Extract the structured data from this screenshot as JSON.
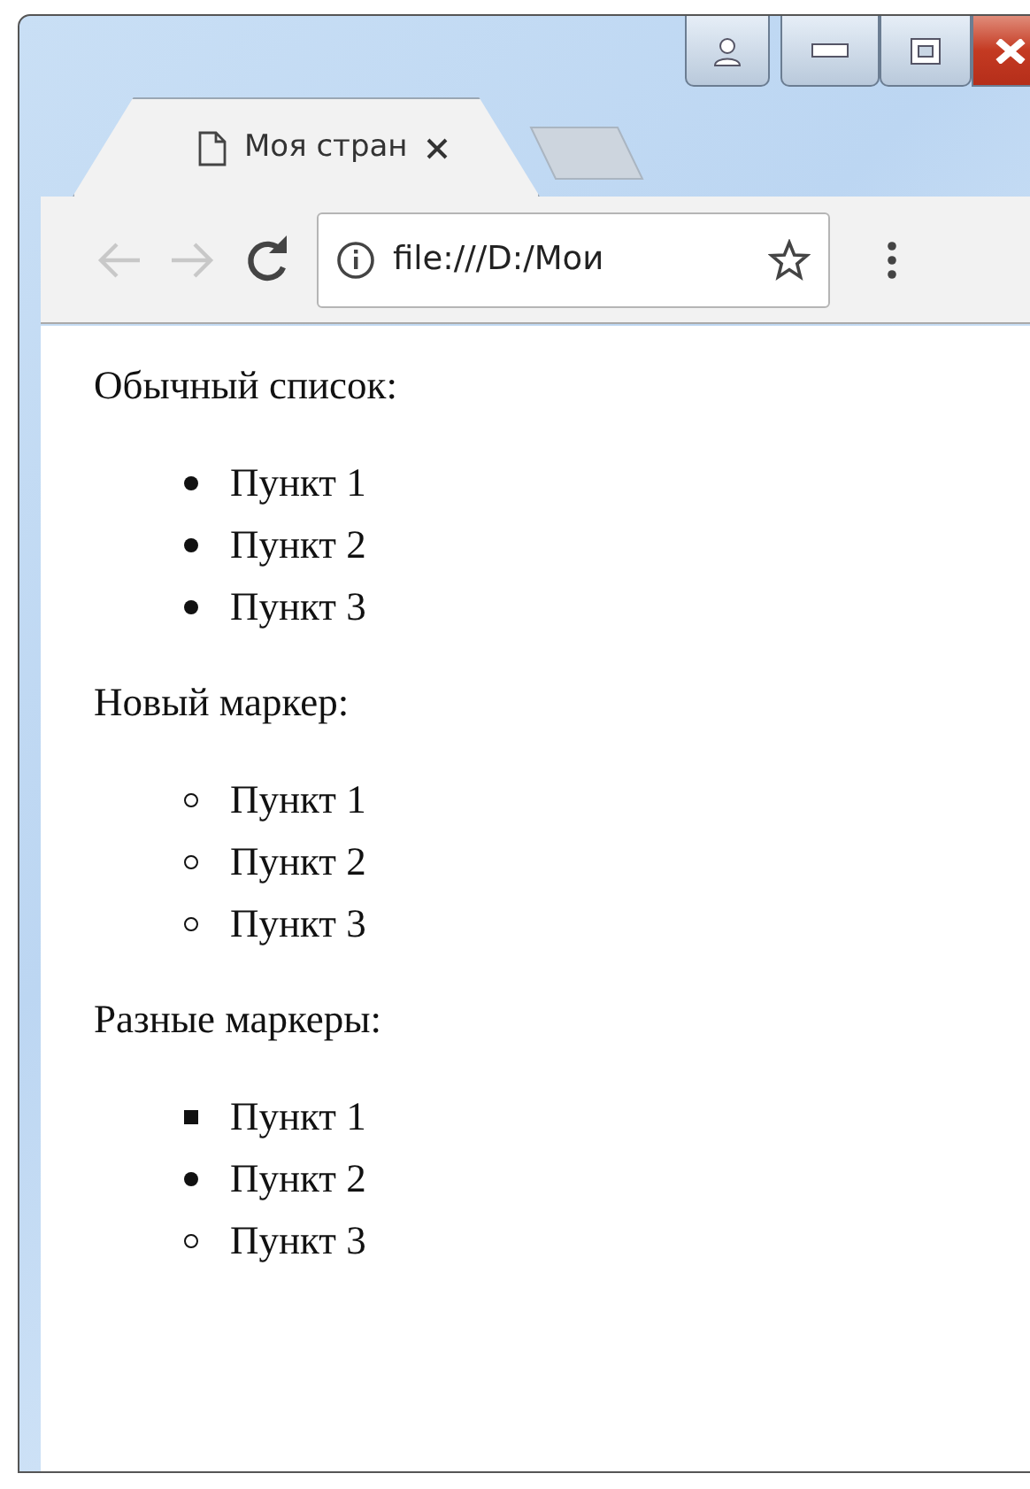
{
  "tab": {
    "title": "Моя стран",
    "selected": true
  },
  "toolbar": {
    "back": {
      "disabled": true
    },
    "forward": {
      "disabled": true
    },
    "address": "file:///D:/Мои"
  },
  "sections": [
    {
      "heading": "Обычный список:",
      "items": [
        {
          "text": "Пункт 1",
          "kind": "disc"
        },
        {
          "text": "Пункт 2",
          "kind": "disc"
        },
        {
          "text": "Пункт 3",
          "kind": "disc"
        }
      ]
    },
    {
      "heading": "Новый маркер:",
      "items": [
        {
          "text": "Пункт 1",
          "kind": "circle"
        },
        {
          "text": "Пункт 2",
          "kind": "circle"
        },
        {
          "text": "Пункт 3",
          "kind": "circle"
        }
      ]
    },
    {
      "heading": "Разные маркеры:",
      "items": [
        {
          "text": "Пункт 1",
          "kind": "square"
        },
        {
          "text": "Пункт 2",
          "kind": "disc"
        },
        {
          "text": "Пункт 3",
          "kind": "circle"
        }
      ]
    }
  ]
}
